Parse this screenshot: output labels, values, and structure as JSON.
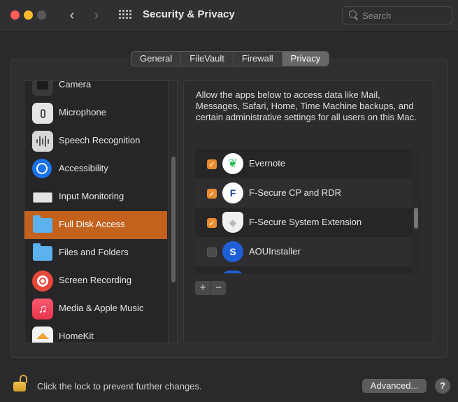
{
  "window": {
    "title": "Security & Privacy",
    "search_placeholder": "Search"
  },
  "tabs": [
    {
      "label": "General",
      "active": false
    },
    {
      "label": "FileVault",
      "active": false
    },
    {
      "label": "Firewall",
      "active": false
    },
    {
      "label": "Privacy",
      "active": true
    }
  ],
  "sidebar": {
    "items": [
      {
        "label": "Camera",
        "icon": "camera-icon"
      },
      {
        "label": "Microphone",
        "icon": "microphone-icon"
      },
      {
        "label": "Speech Recognition",
        "icon": "speech-recognition-icon"
      },
      {
        "label": "Accessibility",
        "icon": "accessibility-icon"
      },
      {
        "label": "Input Monitoring",
        "icon": "keyboard-icon"
      },
      {
        "label": "Full Disk Access",
        "icon": "folder-icon",
        "selected": true
      },
      {
        "label": "Files and Folders",
        "icon": "folder-icon"
      },
      {
        "label": "Screen Recording",
        "icon": "screen-recording-icon"
      },
      {
        "label": "Media & Apple Music",
        "icon": "music-icon"
      },
      {
        "label": "HomeKit",
        "icon": "home-icon"
      }
    ]
  },
  "main": {
    "description": "Allow the apps below to access data like Mail, Messages, Safari, Home, Time Machine backups, and certain administrative settings for all users on this Mac.",
    "apps": [
      {
        "name": "Evernote",
        "checked": true,
        "icon": "evernote-icon"
      },
      {
        "name": "F-Secure CP and RDR",
        "checked": true,
        "icon": "f-secure-icon"
      },
      {
        "name": "F-Secure System Extension",
        "checked": true,
        "icon": "f-secure-extension-icon"
      },
      {
        "name": "AOUInstaller",
        "checked": false,
        "icon": "aou-installer-icon"
      }
    ],
    "add_label": "+",
    "remove_label": "−"
  },
  "footer": {
    "lock_text": "Click the lock to prevent further changes.",
    "advanced_label": "Advanced...",
    "help_label": "?"
  },
  "colors": {
    "selection": "#c2621d",
    "checkbox_checked": "#e98c2f"
  }
}
